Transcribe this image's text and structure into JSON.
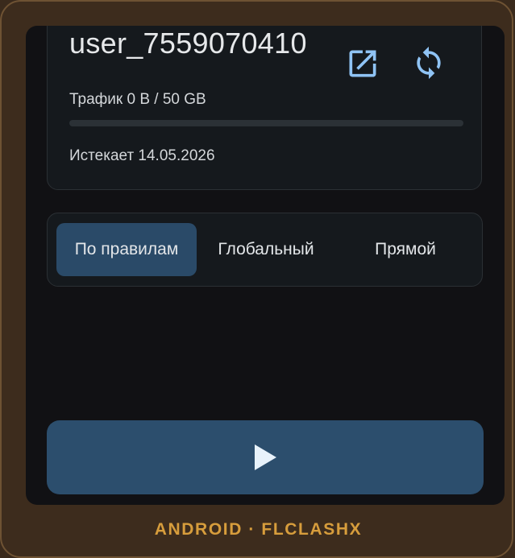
{
  "profile": {
    "name": "user_7559070410",
    "open_icon": "open-external-icon",
    "refresh_icon": "sync-icon",
    "traffic_label": "Трафик 0 B / 50 GB",
    "traffic_used_fraction": 0,
    "expires_label": "Истекает 14.05.2026"
  },
  "modes": {
    "selected": "По правилам",
    "options": [
      "По правилам",
      "Глобальный",
      "Прямой"
    ]
  },
  "play_button": {
    "icon": "play-icon"
  },
  "footer": {
    "label": "ANDROID · FLCLASHX"
  },
  "colors": {
    "accent": "#8fc3f4",
    "selected_mode_bg": "#2a4a68",
    "button_bg": "#2c4e6d",
    "footer_text": "#d79d3c",
    "frame_bg": "#3d2c1d",
    "screen_bg": "#111114"
  }
}
